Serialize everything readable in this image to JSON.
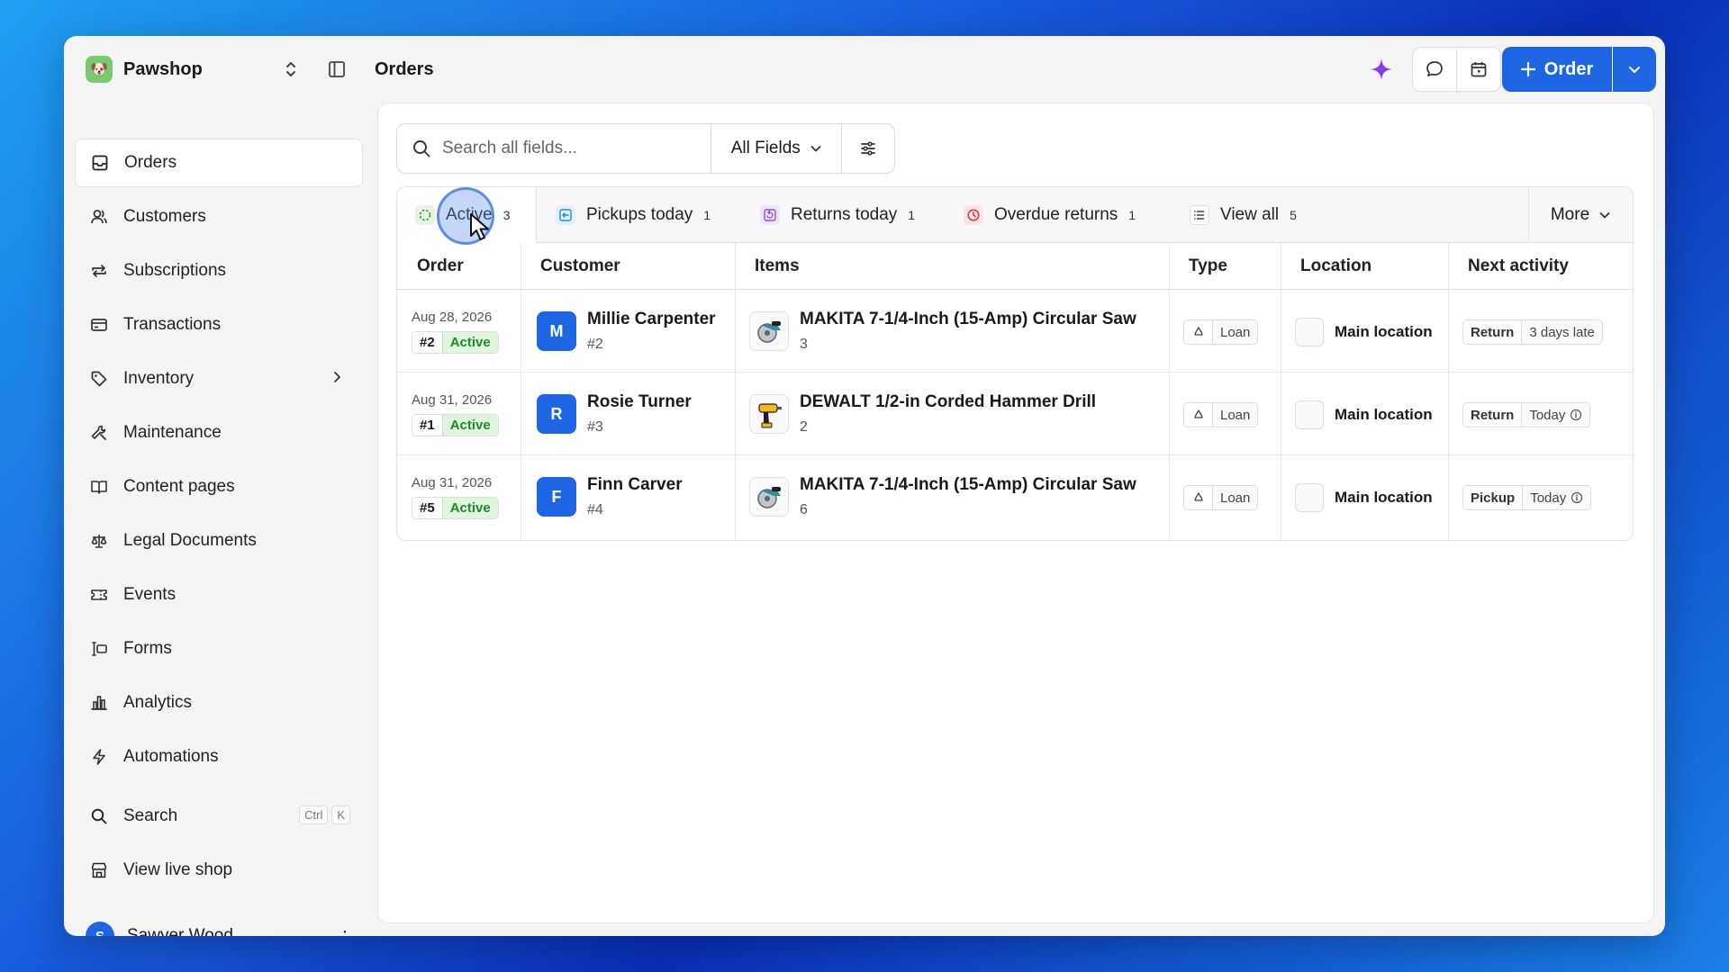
{
  "brand": {
    "name": "Pawshop"
  },
  "header": {
    "title": "Orders",
    "order_button": "Order"
  },
  "sidebar": {
    "items": [
      {
        "label": "Orders",
        "icon": "inbox-icon"
      },
      {
        "label": "Customers",
        "icon": "users-icon"
      },
      {
        "label": "Subscriptions",
        "icon": "repeat-icon"
      },
      {
        "label": "Transactions",
        "icon": "card-icon"
      },
      {
        "label": "Inventory",
        "icon": "tag-icon"
      },
      {
        "label": "Maintenance",
        "icon": "wrench-icon"
      },
      {
        "label": "Content pages",
        "icon": "book-icon"
      },
      {
        "label": "Legal Documents",
        "icon": "scale-icon"
      },
      {
        "label": "Events",
        "icon": "ticket-icon"
      },
      {
        "label": "Forms",
        "icon": "form-icon"
      },
      {
        "label": "Analytics",
        "icon": "bar-chart-icon"
      },
      {
        "label": "Automations",
        "icon": "bolt-icon"
      }
    ],
    "search": {
      "label": "Search",
      "kbd1": "Ctrl",
      "kbd2": "K"
    },
    "live_shop": "View live shop",
    "user": {
      "name": "Sawyer Wood",
      "initial": "S"
    }
  },
  "search": {
    "placeholder": "Search all fields...",
    "fields": "All Fields"
  },
  "tabs": [
    {
      "label": "Active",
      "count": "3"
    },
    {
      "label": "Pickups today",
      "count": "1"
    },
    {
      "label": "Returns today",
      "count": "1"
    },
    {
      "label": "Overdue returns",
      "count": "1"
    },
    {
      "label": "View all",
      "count": "5"
    }
  ],
  "more": "More",
  "columns": [
    "Order",
    "Customer",
    "Items",
    "Type",
    "Location",
    "Next activity"
  ],
  "rows": [
    {
      "date": "Aug 28, 2026",
      "order": "#2",
      "status": "Active",
      "initial": "M",
      "customer": "Millie Carpenter",
      "cust_id": "#2",
      "item": "MAKITA 7-1/4-Inch (15-Amp) Circular Saw",
      "qty": "3",
      "type": "Loan",
      "location": "Main location",
      "activity": "Return",
      "when": "3 days late"
    },
    {
      "date": "Aug 31, 2026",
      "order": "#1",
      "status": "Active",
      "initial": "R",
      "customer": "Rosie Turner",
      "cust_id": "#3",
      "item": "DEWALT 1/2-in Corded Hammer Drill",
      "qty": "2",
      "type": "Loan",
      "location": "Main location",
      "activity": "Return",
      "when": "Today"
    },
    {
      "date": "Aug 31, 2026",
      "order": "#5",
      "status": "Active",
      "initial": "F",
      "customer": "Finn Carver",
      "cust_id": "#4",
      "item": "MAKITA 7-1/4-Inch (15-Amp) Circular Saw",
      "qty": "6",
      "type": "Loan",
      "location": "Main location",
      "activity": "Pickup",
      "when": "Today"
    }
  ]
}
